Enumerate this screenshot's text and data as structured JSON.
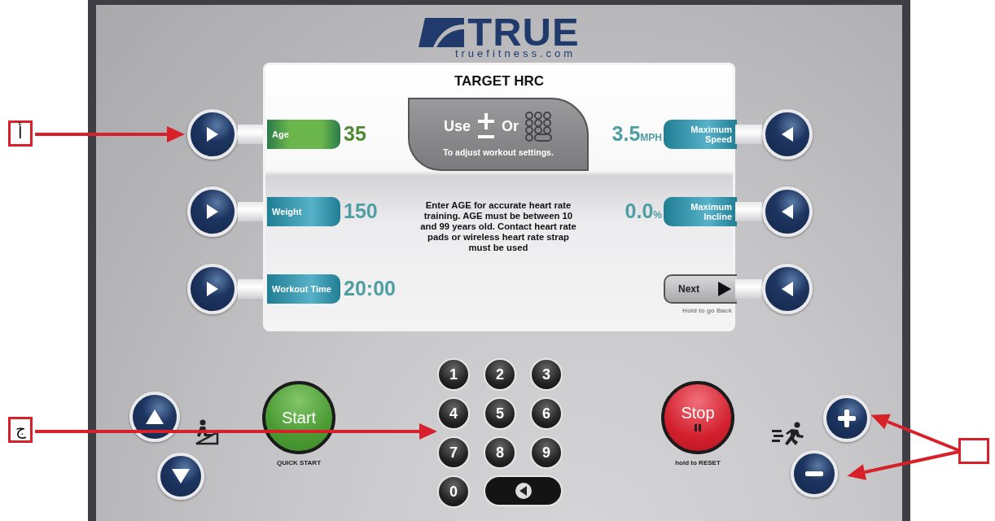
{
  "logo": {
    "brand": "TRUE",
    "website": "truefitness.com"
  },
  "screen": {
    "title": "TARGET HRC",
    "left_fields": [
      {
        "label": "Age",
        "value": "35",
        "selected": true
      },
      {
        "label": "Weight",
        "value": "150",
        "selected": false
      },
      {
        "label": "Workout Time",
        "value": "20:00",
        "selected": false
      }
    ],
    "instruction_box": {
      "use": "Use",
      "or": "Or",
      "caption": "To adjust workout settings."
    },
    "message": "Enter AGE for accurate heart rate training. AGE must be between 10 and 99 years old. Contact heart rate pads or wireless heart rate strap must be used",
    "right_fields": [
      {
        "label": "Maximum Speed",
        "value": "3.5",
        "unit": "MPH"
      },
      {
        "label": "Maximum Incline",
        "value": "0.0",
        "unit": "%"
      }
    ],
    "next_button": {
      "label": "Next",
      "hint": "Hold to go Back"
    }
  },
  "start_button": {
    "label": "Start",
    "caption": "QUICK START"
  },
  "keypad": [
    "1",
    "2",
    "3",
    "4",
    "5",
    "6",
    "7",
    "8",
    "9",
    "0"
  ],
  "stop_button": {
    "label": "Stop",
    "caption": "hold to RESET"
  },
  "callouts": [
    {
      "kind": "text",
      "label": "أ"
    },
    {
      "kind": "text",
      "label": "ج"
    },
    {
      "kind": "blank"
    }
  ]
}
